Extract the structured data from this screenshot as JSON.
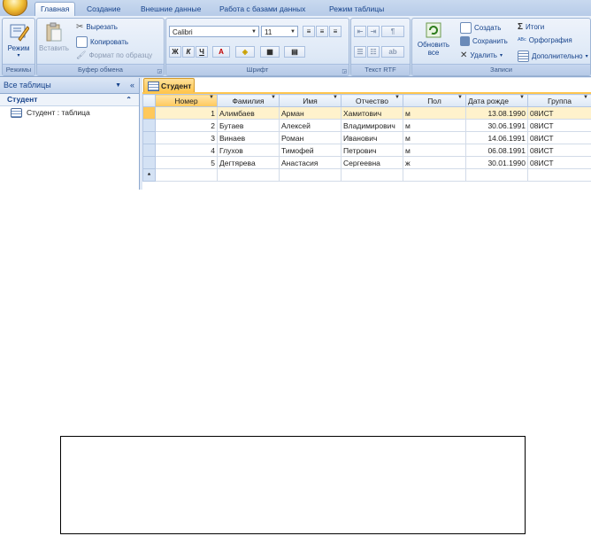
{
  "ribbon_tabs": [
    "Главная",
    "Создание",
    "Внешние данные",
    "Работа с базами данных",
    "Режим таблицы"
  ],
  "groups": {
    "modes": {
      "label": "Режимы",
      "view_label": "Режим"
    },
    "clipboard": {
      "label": "Буфер обмена",
      "paste": "Вставить",
      "cut": "Вырезать",
      "copy": "Копировать",
      "format_painter": "Формат по образцу"
    },
    "font": {
      "label": "Шрифт",
      "font_name": "Calibri",
      "font_size": "11",
      "bold": "Ж",
      "italic": "К",
      "underline": "Ч",
      "font_color": "A"
    },
    "rtf": {
      "label": "Текст RTF"
    },
    "records": {
      "label": "Записи",
      "refresh": "Обновить",
      "refresh_sub": "все",
      "new": "Создать",
      "save": "Сохранить",
      "delete": "Удалить",
      "totals": "Итоги",
      "spelling": "Орфография",
      "more": "Дополнительно"
    }
  },
  "nav": {
    "header": "Все таблицы",
    "group": "Студент",
    "item": "Студент : таблица"
  },
  "doc_tab": "Студент",
  "table": {
    "columns": [
      "Номер",
      "Фамилия",
      "Имя",
      "Отчество",
      "Пол",
      "Дата рожде",
      "Группа"
    ],
    "rows": [
      [
        "1",
        "Алимбаев",
        "Арман",
        "Хамитович",
        "м",
        "13.08.1990",
        "08ИСТ"
      ],
      [
        "2",
        "Бутаев",
        "Алексей",
        "Владимирович",
        "м",
        "30.06.1991",
        "08ИСТ"
      ],
      [
        "3",
        "Винаев",
        "Роман",
        "Иванович",
        "м",
        "14.06.1991",
        "08ИСТ"
      ],
      [
        "4",
        "Глухов",
        "Тимофей",
        "Петрович",
        "м",
        "06.08.1991",
        "08ИСТ"
      ],
      [
        "5",
        "Дегтярева",
        "Анастасия",
        "Сергеевна",
        "ж",
        "30.01.1990",
        "08ИСТ"
      ]
    ],
    "new_row_marker": "*"
  },
  "colors": {
    "accent": "#ffc64f",
    "ribbon": "#dfe8f5",
    "text_blue": "#15428b"
  }
}
